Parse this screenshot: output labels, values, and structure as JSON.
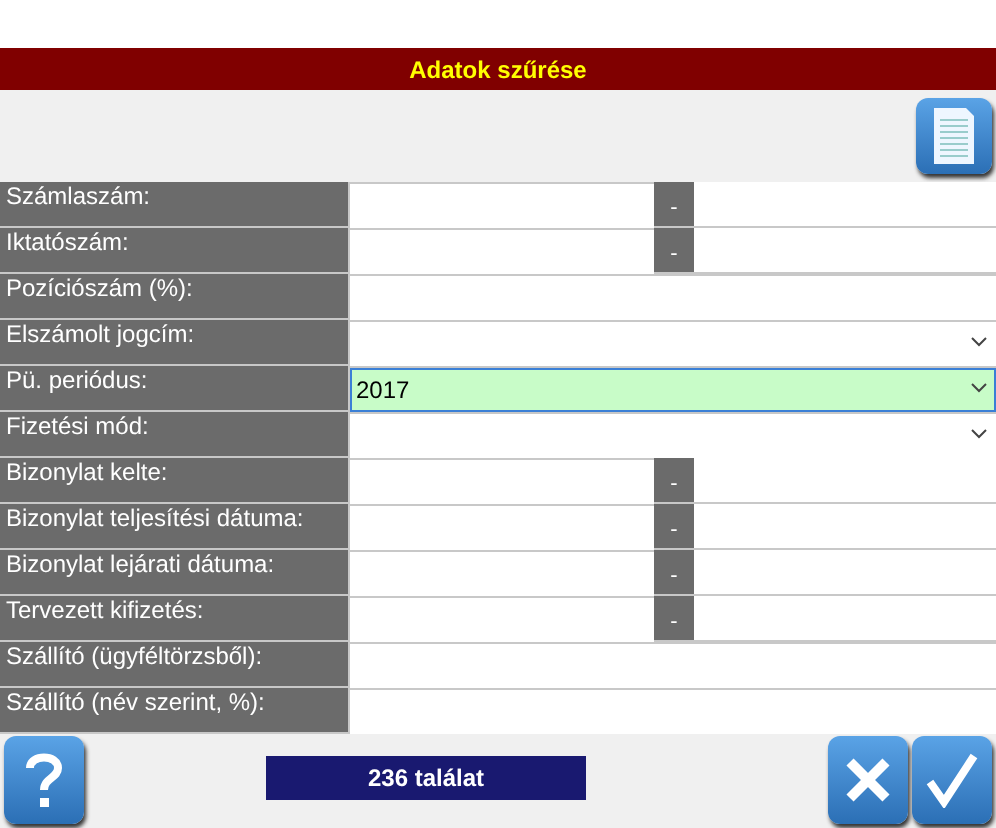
{
  "title": "Adatok szűrése",
  "rows": [
    {
      "label": "Számlaszám:",
      "kind": "range",
      "focused": false,
      "separator": "-"
    },
    {
      "label": "Iktatószám:",
      "kind": "range",
      "focused": false,
      "separator": "-"
    },
    {
      "label": "Pozíciószám (%):",
      "kind": "text",
      "focused": false
    },
    {
      "label": "Elszámolt jogcím:",
      "kind": "select",
      "focused": false
    },
    {
      "label": "Pü. periódus:",
      "kind": "select",
      "focused": true,
      "value": "2017"
    },
    {
      "label": "Fizetési mód:",
      "kind": "select",
      "focused": false
    },
    {
      "label": "Bizonylat kelte:",
      "kind": "range",
      "focused": false,
      "separator": "-"
    },
    {
      "label": "Bizonylat teljesítési dátuma:",
      "kind": "range",
      "focused": false,
      "separator": "-"
    },
    {
      "label": "Bizonylat lejárati dátuma:",
      "kind": "range",
      "focused": false,
      "separator": "-"
    },
    {
      "label": "Tervezett kifizetés:",
      "kind": "range",
      "focused": false,
      "separator": "-"
    },
    {
      "label": "Szállító (ügyféltörzsből):",
      "kind": "text",
      "focused": false
    },
    {
      "label": "Szállító (név szerint, %):",
      "kind": "text",
      "focused": false
    }
  ],
  "status": "236 találat"
}
